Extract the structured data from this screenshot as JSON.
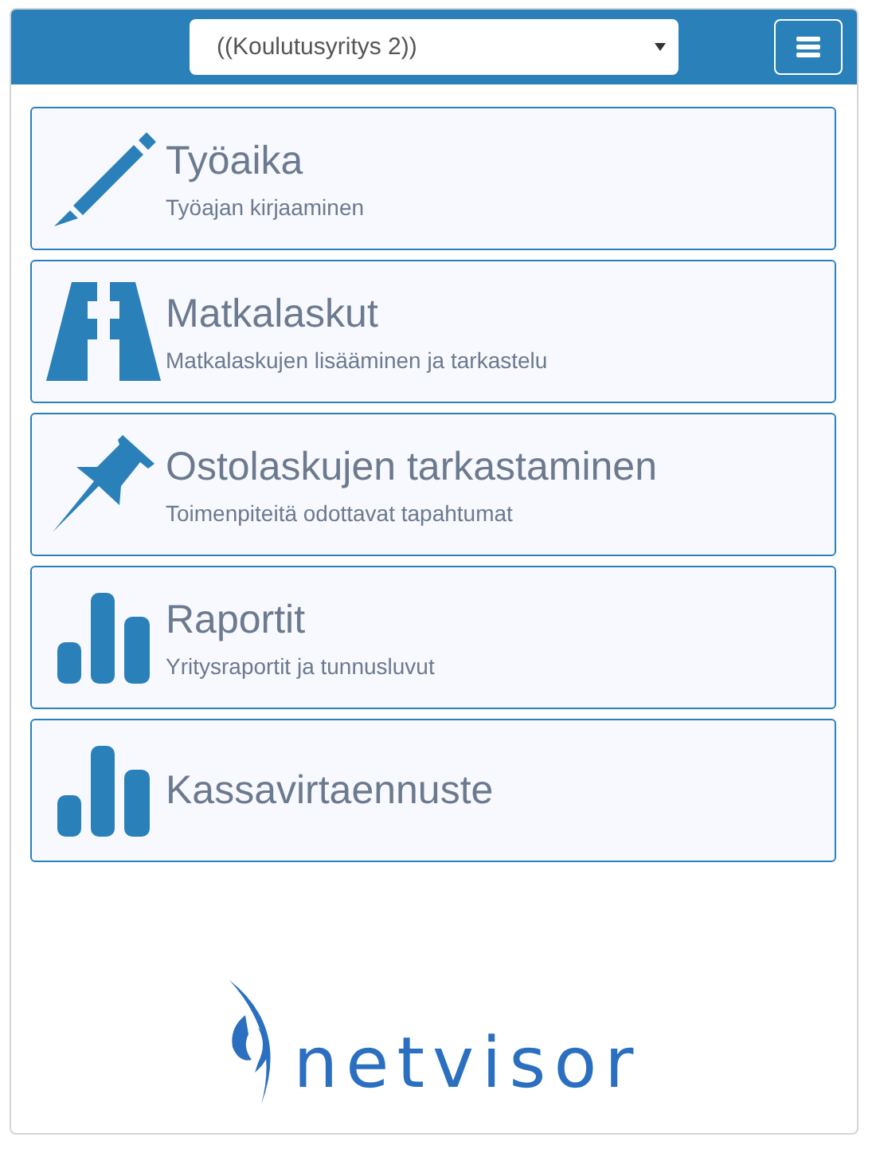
{
  "header": {
    "company_select": {
      "value": "((Koulutusyritys 2))"
    }
  },
  "menu_cards": [
    {
      "kind": "pencil",
      "title": "Työaika",
      "subtitle": "Työajan kirjaaminen"
    },
    {
      "kind": "road",
      "title": "Matkalaskut",
      "subtitle": "Matkalaskujen lisääminen ja tarkastelu"
    },
    {
      "kind": "pin",
      "title": "Ostolaskujen tarkastaminen",
      "subtitle": "Toimenpiteitä odottavat tapahtumat"
    },
    {
      "kind": "chart",
      "title": "Raportit",
      "subtitle": "Yritysraportit ja tunnusluvut"
    },
    {
      "kind": "chart",
      "title": "Kassavirtaennuste"
    }
  ],
  "logo": {
    "text": "netvisor"
  }
}
